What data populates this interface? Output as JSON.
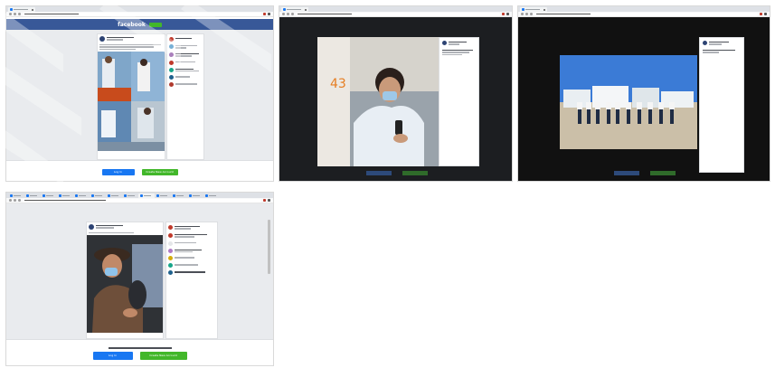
{
  "facebook": {
    "logo": "facebook",
    "login_button": "Log In",
    "create_button": "Create New Account",
    "prompt": ""
  },
  "colors": {
    "facebook_blue": "#385898",
    "button_blue": "#1877f2",
    "button_green": "#42b72a",
    "photo_viewer_bg": "#1c1e21"
  },
  "icons": [
    "facebook-favicon",
    "close-icon",
    "back-icon",
    "forward-icon",
    "reload-icon",
    "extension-icon",
    "menu-icon"
  ]
}
